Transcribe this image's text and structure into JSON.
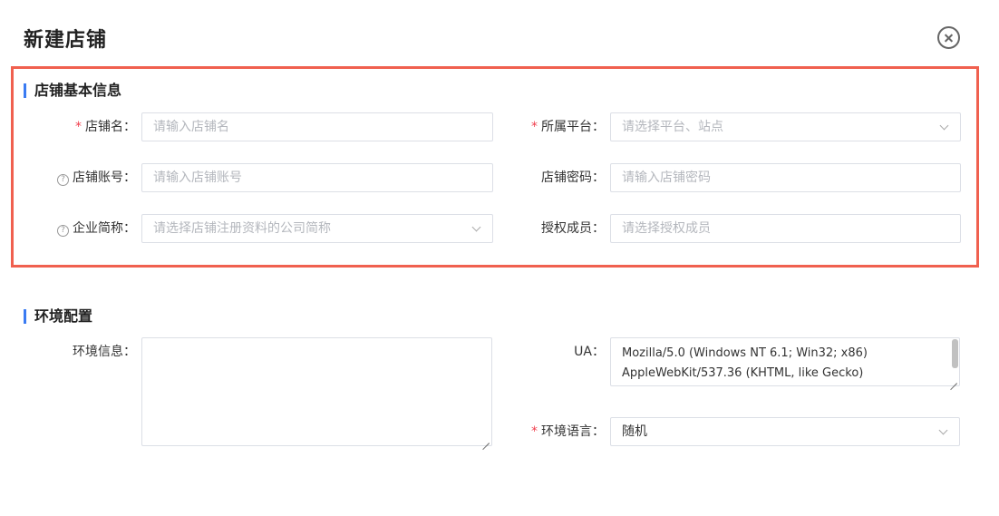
{
  "dialog": {
    "title": "新建店铺"
  },
  "basic": {
    "section_title": "店铺基本信息",
    "shop_name": {
      "label": "店铺名",
      "placeholder": "请输入店铺名",
      "required": true
    },
    "platform": {
      "label": "所属平台",
      "placeholder": "请选择平台、站点",
      "required": true
    },
    "account": {
      "label": "店铺账号",
      "placeholder": "请输入店铺账号",
      "help_icon": "question-circle-icon"
    },
    "password": {
      "label": "店铺密码",
      "placeholder": "请输入店铺密码"
    },
    "company": {
      "label": "企业简称",
      "placeholder": "请选择店铺注册资料的公司简称",
      "help_icon": "question-circle-icon"
    },
    "members": {
      "label": "授权成员",
      "placeholder": "请选择授权成员"
    }
  },
  "env": {
    "section_title": "环境配置",
    "env_info": {
      "label": "环境信息",
      "value": ""
    },
    "ua": {
      "label": "UA",
      "line1": "Mozilla/5.0 (Windows NT 6.1; Win32; x86)",
      "line2": "AppleWebKit/537.36 (KHTML, like Gecko)"
    },
    "language": {
      "label": "环境语言",
      "value": "随机",
      "required": true
    }
  },
  "colors": {
    "accent": "#3a7bf2",
    "required": "#f0404f",
    "highlight": "#f0604f"
  }
}
